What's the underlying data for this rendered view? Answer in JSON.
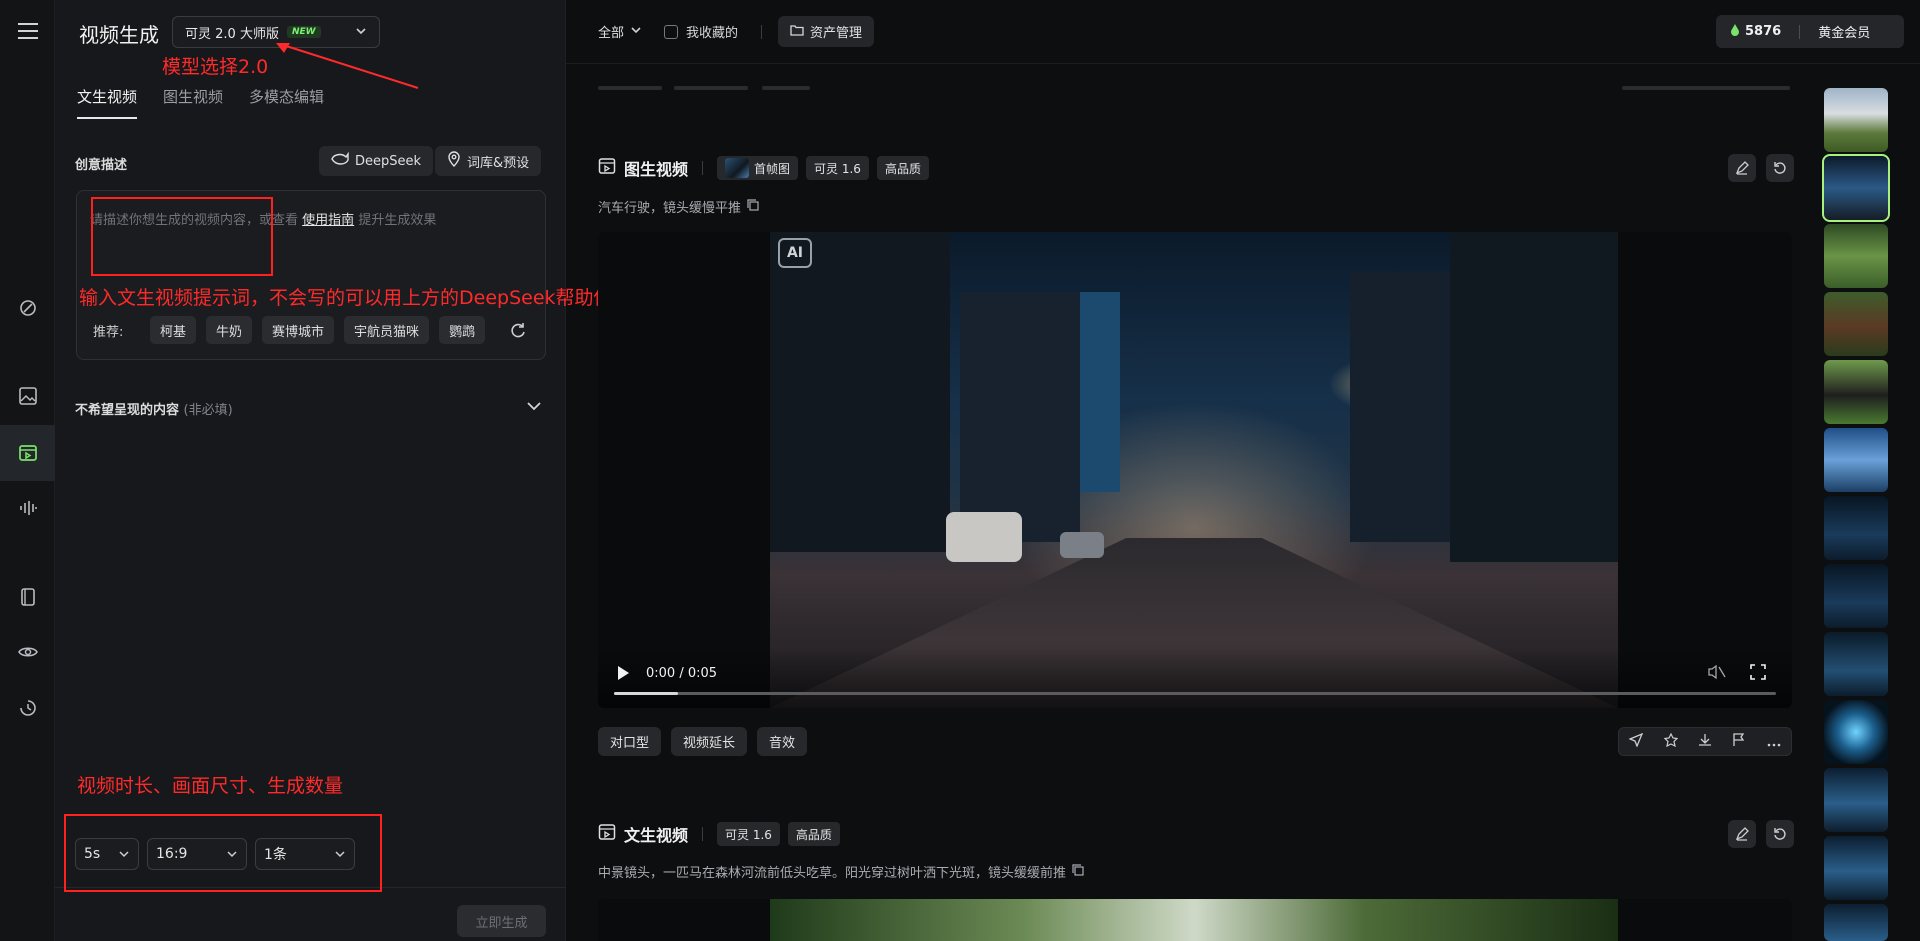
{
  "app": {
    "page_title": "视频生成",
    "model_select": {
      "value": "可灵 2.0 大师版",
      "badge": "NEW"
    }
  },
  "tabs": [
    {
      "label": "文生视频",
      "active": true
    },
    {
      "label": "图生视频",
      "active": false
    },
    {
      "label": "多模态编辑",
      "active": false
    }
  ],
  "creative": {
    "label": "创意描述",
    "deepseek_label": "DeepSeek",
    "library_label": "词库&预设",
    "placeholder_prefix": "请描述你想生成的视频内容，或查看",
    "placeholder_link": "使用指南",
    "placeholder_suffix": "提升生成效果",
    "recommend_label": "推荐:",
    "recommend": [
      "柯基",
      "牛奶",
      "赛博城市",
      "宇航员猫咪",
      "鹦鹉"
    ]
  },
  "negative": {
    "label": "不希望呈现的内容",
    "optional": "(非必填)"
  },
  "settings": {
    "duration": "5s",
    "ratio": "16:9",
    "count": "1条"
  },
  "generate_label": "立即生成",
  "annotations": {
    "model": "模型选择2.0",
    "prompt": "输入文生视频提示词，不会写的可以用上方的DeepSeek帮助你写",
    "settings": "视频时长、画面尺寸、生成数量"
  },
  "topbar": {
    "filter": "全部",
    "favorites": "我收藏的",
    "assets": "资产管理",
    "points": "5876",
    "membership": "黄金会员"
  },
  "card1": {
    "title": "图生视频",
    "tags": [
      "首帧图",
      "可灵 1.6",
      "高品质"
    ],
    "description": "汽车行驶，镜头缓慢平推",
    "time": "0:00 / 0:05",
    "progress": 0.055,
    "ai_badge": "AI",
    "actions": [
      "对口型",
      "视频延长",
      "音效"
    ]
  },
  "card2": {
    "title": "文生视频",
    "tags": [
      "可灵 1.6",
      "高品质"
    ],
    "description": "中景镜头，一匹马在森林河流前低头吃草。阳光穿过树叶洒下光斑，镜头缓缓前推"
  },
  "colors": {
    "accent_green": "#a6f27c",
    "annotation_red": "#ff2a2a"
  }
}
